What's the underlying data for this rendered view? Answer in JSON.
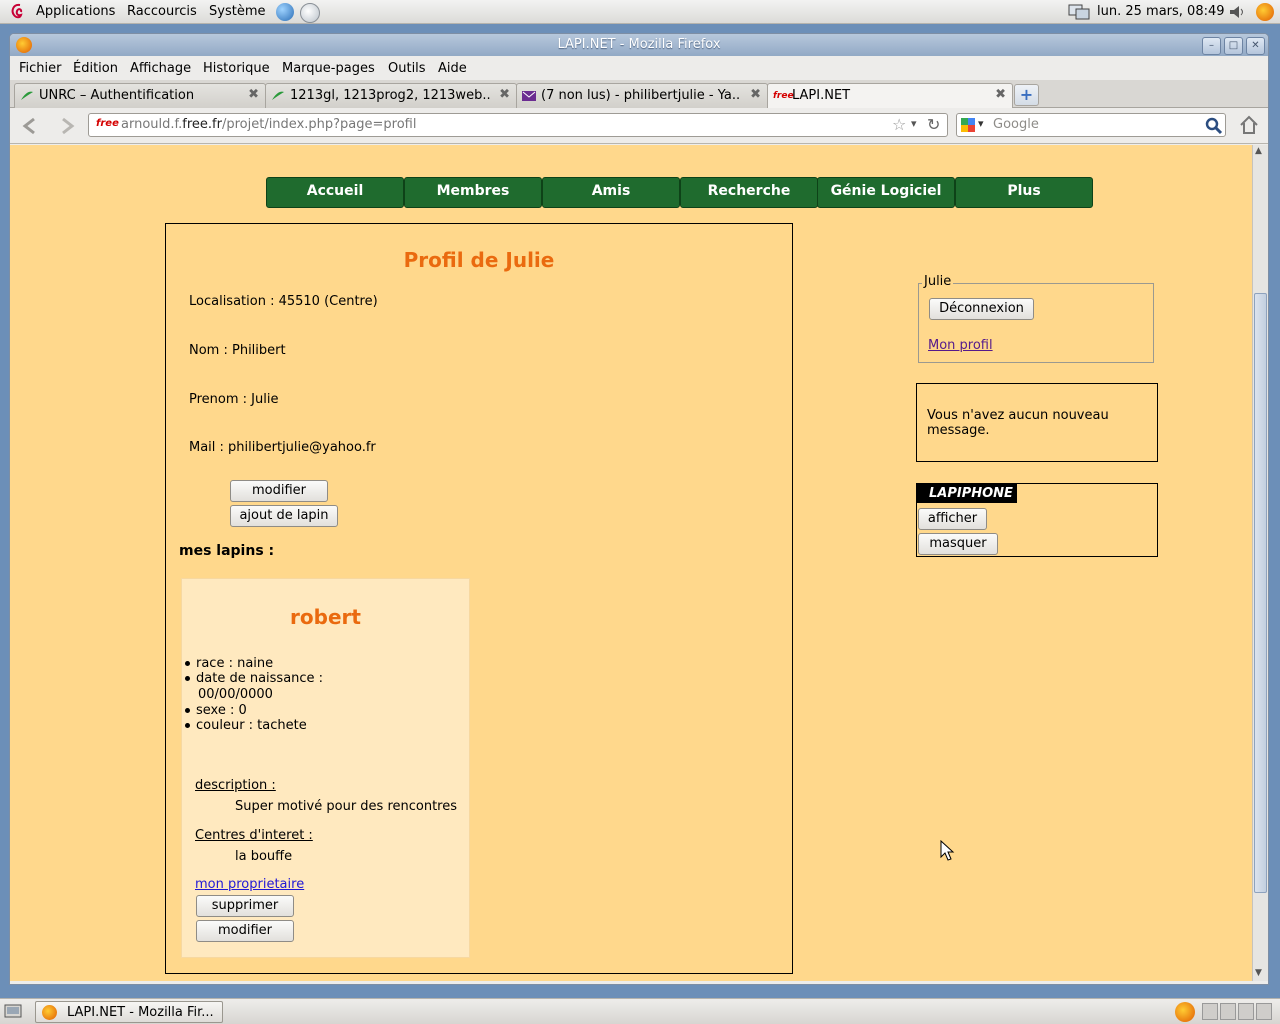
{
  "panel": {
    "applications": "Applications",
    "shortcuts": "Raccourcis",
    "system": "Système",
    "clock": "lun. 25 mars, 08:49"
  },
  "window": {
    "title": "LAPI.NET - Mozilla Firefox"
  },
  "menubar": [
    "Fichier",
    "Édition",
    "Affichage",
    "Historique",
    "Marque-pages",
    "Outils",
    "Aide"
  ],
  "tabs": [
    {
      "label": "UNRC – Authentification",
      "icon": "unrc-leaf-icon"
    },
    {
      "label": "1213gl, 1213prog2, 1213web...",
      "icon": "unrc-leaf-icon"
    },
    {
      "label": "(7 non lus) - philibertjulie - Ya...",
      "icon": "mail-icon"
    },
    {
      "label": "LAPI.NET",
      "icon": "free-icon",
      "active": true
    }
  ],
  "navbar": {
    "url_prefix": "arnould.f.",
    "url_domain": "free.fr",
    "url_suffix": "/projet/index.php?page=profil",
    "search_placeholder": "Google"
  },
  "site_nav": [
    "Accueil",
    "Membres",
    "Amis",
    "Recherche",
    "Génie Logiciel",
    "Plus"
  ],
  "profile": {
    "heading": "Profil de Julie",
    "localisation": "Localisation : 45510 (Centre)",
    "nom": "Nom : Philibert",
    "prenom": "Prenom : Julie",
    "mail": "Mail : philibertjulie@yahoo.fr",
    "modify_label": "modifier",
    "add_lapin_label": "ajout de lapin",
    "mes_lapins": "mes lapins :"
  },
  "lapin": {
    "name": "robert",
    "race": "race : naine",
    "date_label": "date de naissance :",
    "date_value": "00/00/0000",
    "sexe": "sexe : 0",
    "couleur": "couleur : tachete",
    "description_label": "description :",
    "description": "Super motivé pour des rencontres",
    "interests_label": "Centres d'interet :",
    "interests": "la bouffe",
    "owner_link": "mon proprietaire",
    "delete_label": "supprimer",
    "modify_label": "modifier"
  },
  "sidebar": {
    "login_legend": "Julie",
    "logout_label": "Déconnexion",
    "my_profile_link": "Mon profil",
    "message_line1": "Vous n'avez aucun nouveau",
    "message_line2": "message.",
    "lapiphone_title": "LAPIPHONE",
    "show_label": "afficher",
    "hide_label": "masquer"
  },
  "taskbar": {
    "task_label": "LAPI.NET - Mozilla Fir..."
  },
  "colors": {
    "page_bg": "#ffd88c",
    "nav_green": "#1f6b2e",
    "heading_orange": "#ea6a0f",
    "link": "#551a8b"
  }
}
